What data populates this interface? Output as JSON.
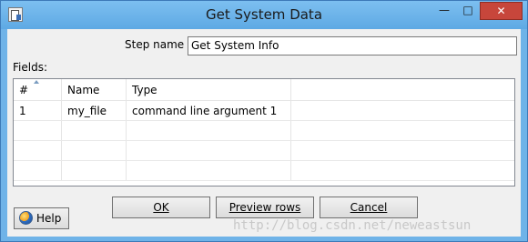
{
  "window": {
    "title": "Get System Data",
    "minimize_glyph": "—",
    "maximize_glyph": "□",
    "close_glyph": "✕",
    "app_icon": "document-icon"
  },
  "form": {
    "step_name_label": "Step name",
    "step_name_value": "Get System Info",
    "fields_label": "Fields:"
  },
  "grid": {
    "columns": [
      "#",
      "Name",
      "Type",
      ""
    ],
    "rows": [
      [
        "1",
        "my_file",
        "command line argument 1",
        ""
      ],
      [
        "",
        "",
        "",
        ""
      ],
      [
        "",
        "",
        "",
        ""
      ],
      [
        "",
        "",
        "",
        ""
      ]
    ]
  },
  "buttons": {
    "ok_label": "OK",
    "preview_label": "Preview rows",
    "cancel_label": "Cancel",
    "help_label": "Help"
  },
  "watermark": "http://blog.csdn.net/neweastsun",
  "colors": {
    "titlebar": "#6fb3e8",
    "close_button": "#c7463b",
    "dialog_bg": "#f0f0f0"
  }
}
